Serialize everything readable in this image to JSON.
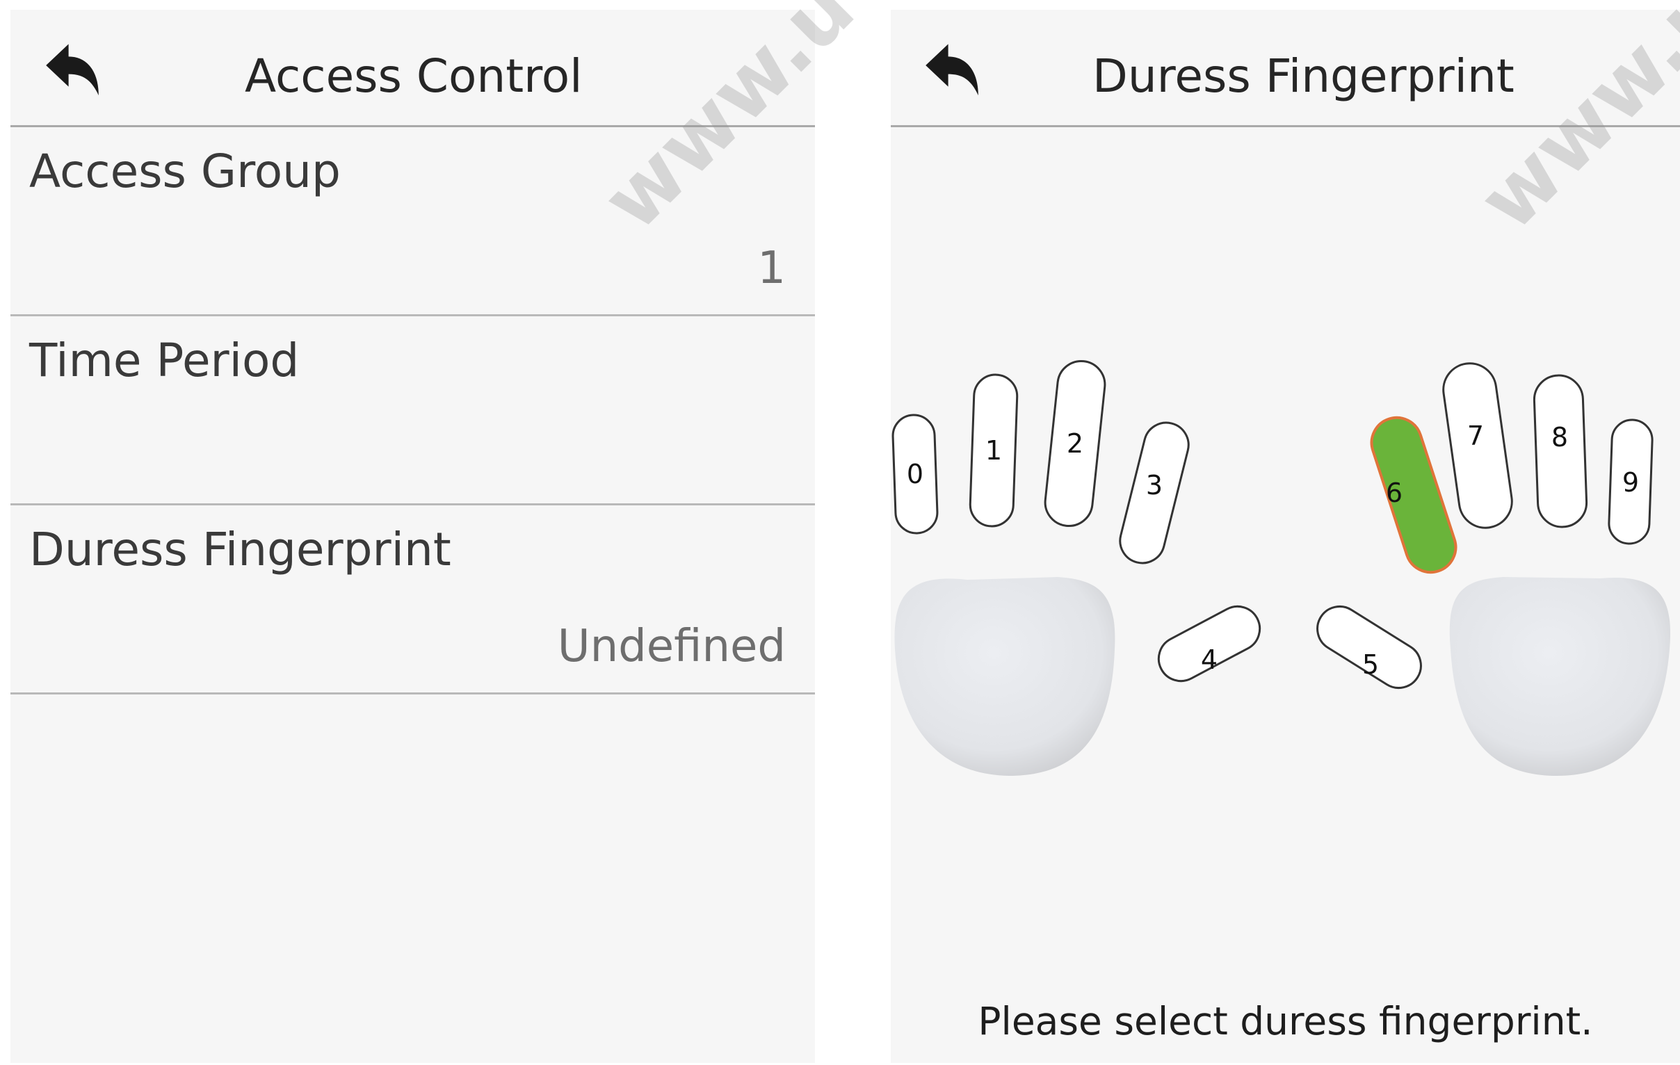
{
  "left_screen": {
    "title": "Access Control",
    "back_icon": "back-arrow-icon",
    "rows": [
      {
        "label": "Access Group",
        "value": "1"
      },
      {
        "label": "Time Period",
        "value": ""
      },
      {
        "label": "Duress Fingerprint",
        "value": "Undefined"
      }
    ]
  },
  "right_screen": {
    "title": "Duress Fingerprint",
    "back_icon": "back-arrow-icon",
    "fingers": [
      "0",
      "1",
      "2",
      "3",
      "4",
      "5",
      "6",
      "7",
      "8",
      "9"
    ],
    "selected_finger": "6",
    "selected_fill": "#6ab43a",
    "selected_stroke": "#e0743a",
    "hint": "Please select duress fingerprint."
  },
  "watermark": "www.u"
}
